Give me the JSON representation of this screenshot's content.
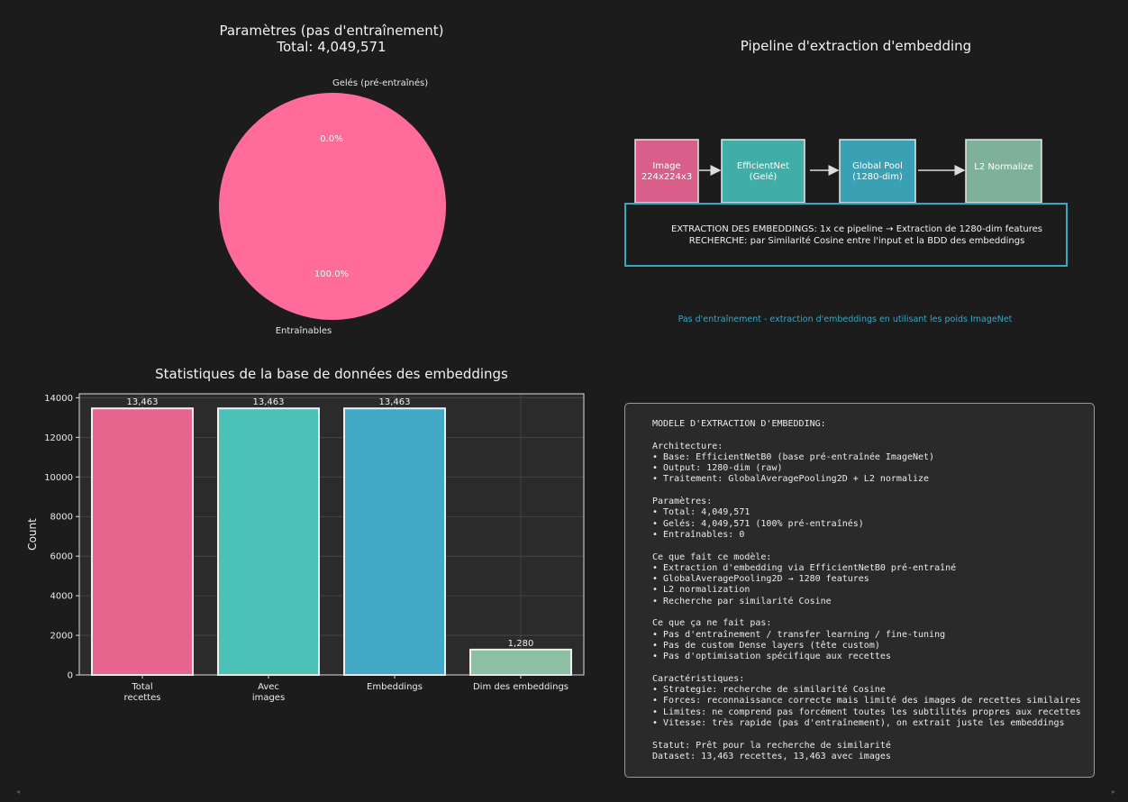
{
  "pie": {
    "title": "Paramètres (pas d'entraînement)",
    "subtitle": "Total: 4,049,571",
    "slices": [
      {
        "label": "Gelés (pré-entraînés)",
        "pct_label": "0.0%",
        "value": 0.0,
        "color": "#ff6b9a"
      },
      {
        "label": "Entraînables",
        "pct_label": "100.0%",
        "value": 100.0,
        "color": "#ff6b9a"
      }
    ]
  },
  "pipeline": {
    "title": "Pipeline d'extraction d'embedding",
    "steps": [
      {
        "line1": "Image",
        "line2": "224x224x3",
        "color": "#d95f8a"
      },
      {
        "line1": "EfficientNet",
        "line2": "(Gelé)",
        "color": "#40aea6"
      },
      {
        "line1": "Global Pool",
        "line2": "(1280-dim)",
        "color": "#3aa0b4"
      },
      {
        "line1": "L2 Normalize",
        "line2": "",
        "color": "#7fb09a"
      }
    ],
    "box_line1": "EXTRACTION DES EMBEDDINGS: 1x ce pipeline → Extraction de 1280-dim features",
    "box_line2": "RECHERCHE: par Similarité Cosine entre l'input et la BDD des embeddings",
    "footnote": "Pas d'entraînement - extraction d'embeddings en utilisant les poids ImageNet",
    "accent": "#3aa6c2"
  },
  "chart_data": {
    "type": "bar",
    "title": "Statistiques de la base de données des embeddings",
    "ylabel": "Count",
    "xlabel": "",
    "categories": [
      "Total\nrecettes",
      "Avec\nimages",
      "Embeddings",
      "Dim des embeddings"
    ],
    "values": [
      13463,
      13463,
      13463,
      1280
    ],
    "value_labels": [
      "13,463",
      "13,463",
      "13,463",
      "1,280"
    ],
    "colors": [
      "#e8658f",
      "#4cc1b7",
      "#41a9c5",
      "#8dbfa4"
    ],
    "ylim": [
      0,
      14200
    ],
    "yticks": [
      0,
      2000,
      4000,
      6000,
      8000,
      10000,
      12000,
      14000
    ],
    "grid": true
  },
  "info": {
    "lines": [
      "MODELE D'EXTRACTION D'EMBEDDING:",
      "",
      "Architecture:",
      "• Base: EfficientNetB0 (base pré-entraînée ImageNet)",
      "• Output: 1280-dim (raw)",
      "• Traitement: GlobalAveragePooling2D + L2 normalize",
      "",
      "Paramètres:",
      "• Total: 4,049,571",
      "• Gelés: 4,049,571 (100% pré-entraînés)",
      "• Entraînables: 0",
      "",
      "Ce que fait ce modèle:",
      "• Extraction d'embedding via EfficientNetB0 pré-entraîné",
      "• GlobalAveragePooling2D → 1280 features",
      "• L2 normalization",
      "• Recherche par similarité Cosine",
      "",
      "Ce que ça ne fait pas:",
      "• Pas d'entraînement / transfer learning / fine-tuning",
      "• Pas de custom Dense layers (tête custom)",
      "• Pas d'optimisation spécifique aux recettes",
      "",
      "Caractéristiques:",
      "• Strategie: recherche de similarité Cosine",
      "• Forces: reconnaissance correcte mais limité des images de recettes similaires",
      "• Limites: ne comprend pas forcément toutes les subtilités propres aux recettes",
      "• Vitesse: très rapide (pas d'entraînement), on extrait juste les embeddings",
      "",
      "Statut: Prêt pour la recherche de similarité",
      "Dataset: 13,463 recettes, 13,463 avec images"
    ]
  }
}
